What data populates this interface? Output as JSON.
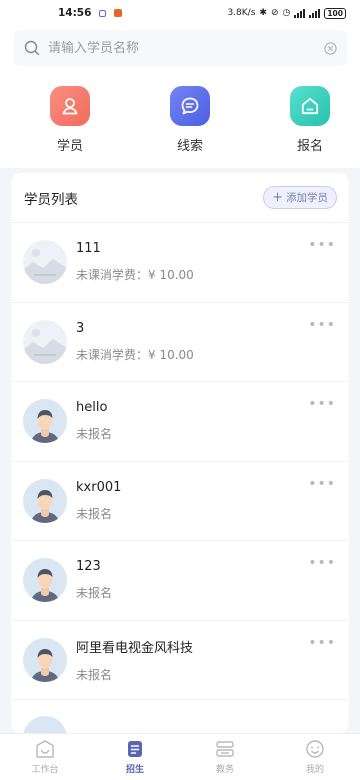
{
  "status_bar": {
    "time": "14:56",
    "network_speed": "3.8K/s",
    "battery": "100"
  },
  "search": {
    "placeholder": "请输入学员名称"
  },
  "quick_actions": [
    {
      "label": "学员",
      "icon": "student-icon",
      "color": "#f47b6e"
    },
    {
      "label": "线索",
      "icon": "chat-icon",
      "color": "#5b6ee8"
    },
    {
      "label": "报名",
      "icon": "home-icon",
      "color": "#33d1bf"
    }
  ],
  "student_list": {
    "title": "学员列表",
    "add_button": "添加学员",
    "items": [
      {
        "name": "111",
        "detail": "未课消学费：¥ 10.00",
        "avatar": "placeholder-image-icon"
      },
      {
        "name": "3",
        "detail": "未课消学费：¥ 10.00",
        "avatar": "placeholder-image-icon"
      },
      {
        "name": " hello",
        "detail": "未报名",
        "avatar": "default-person-avatar"
      },
      {
        "name": "kxr001",
        "detail": "未报名",
        "avatar": "default-person-avatar"
      },
      {
        "name": "123",
        "detail": "未报名",
        "avatar": "default-person-avatar"
      },
      {
        "name": "阿里看电视金风科技",
        "detail": "未报名",
        "avatar": "default-person-avatar"
      }
    ]
  },
  "tabbar": {
    "items": [
      {
        "label": "工作台",
        "icon": "smile-box-icon",
        "active": false
      },
      {
        "label": "招生",
        "icon": "document-icon",
        "active": true
      },
      {
        "label": "教务",
        "icon": "layers-icon",
        "active": false
      },
      {
        "label": "我的",
        "icon": "face-icon",
        "active": false
      }
    ]
  },
  "colors": {
    "accent": "#5b63b5",
    "background": "#f4f5f9"
  }
}
